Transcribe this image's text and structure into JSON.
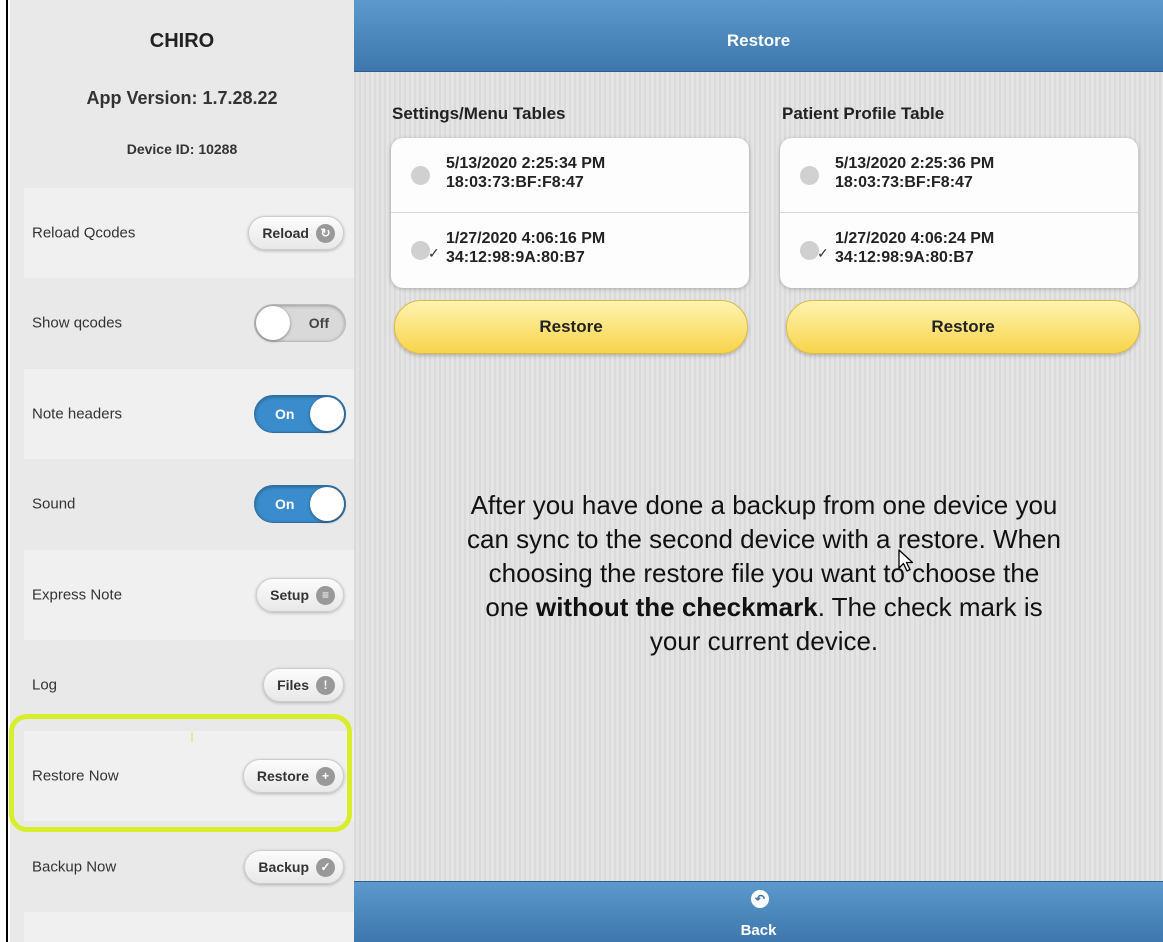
{
  "sidebar": {
    "title": "CHIRO",
    "app_version": "App Version: 1.7.28.22",
    "device_id": "Device ID: 10288",
    "rows": {
      "reload": {
        "label": "Reload Qcodes",
        "button": "Reload",
        "icon": "refresh-icon"
      },
      "show_qcodes": {
        "label": "Show qcodes",
        "toggle": "Off",
        "state": "off"
      },
      "note_headers": {
        "label": "Note headers",
        "toggle": "On",
        "state": "on"
      },
      "sound": {
        "label": "Sound",
        "toggle": "On",
        "state": "on"
      },
      "express_note": {
        "label": "Express Note",
        "button": "Setup",
        "icon": "menu-icon"
      },
      "log": {
        "label": "Log",
        "button": "Files",
        "icon": "alert-icon"
      },
      "restore_now": {
        "label": "Restore Now",
        "button": "Restore",
        "icon": "plus-icon"
      },
      "backup_now": {
        "label": "Backup Now",
        "button": "Backup",
        "icon": "check-icon"
      }
    },
    "highlight_color": "#d9ee2a"
  },
  "header": {
    "title": "Restore"
  },
  "settings_tables": {
    "title": "Settings/Menu Tables",
    "items": [
      {
        "line1": "5/13/2020 2:25:34 PM",
        "line2": "18:03:73:BF:F8:47",
        "checked": false
      },
      {
        "line1": "1/27/2020 4:06:16 PM",
        "line2": "34:12:98:9A:80:B7",
        "checked": true,
        "check": "✓"
      }
    ],
    "button": "Restore"
  },
  "patient_table": {
    "title": "Patient Profile Table",
    "items": [
      {
        "line1": "5/13/2020 2:25:36 PM",
        "line2": "18:03:73:BF:F8:47",
        "checked": false
      },
      {
        "line1": "1/27/2020 4:06:24 PM",
        "line2": "34:12:98:9A:80:B7",
        "checked": true,
        "check": "✓"
      }
    ],
    "button": "Restore"
  },
  "info": {
    "part1": "After you have done a backup from one device you can sync to the second device with a restore.  When choosing the restore file you want to choose the one ",
    "bold": "without the checkmark",
    "part2": ".  The check mark is your current device."
  },
  "footer": {
    "back_label": "Back",
    "icon": "back-icon"
  },
  "colors": {
    "header_blue": "#4a86bd",
    "toggle_on": "#3a8ccc",
    "restore_yellow": "#f8d44b"
  }
}
